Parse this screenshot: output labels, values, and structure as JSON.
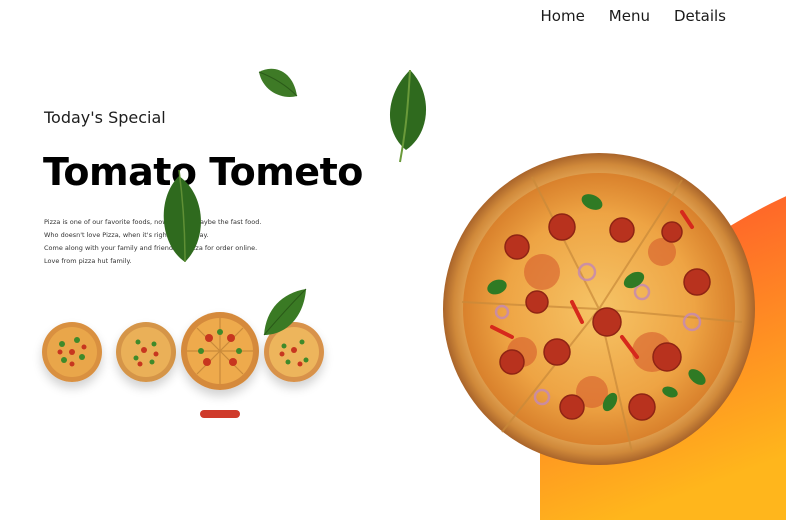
{
  "nav": {
    "items": [
      {
        "label": "Home"
      },
      {
        "label": "Menu"
      },
      {
        "label": "Details"
      }
    ]
  },
  "hero": {
    "subtitle": "Today's Special",
    "title": "Tomato Tometo",
    "description_lines": [
      "Pizza is one of our favorite foods, now-a-days maybe the fast food.",
      "Who doesn't love Pizza, when it's right by the way.",
      "Come along with your family and friends in Pizza for order online.",
      "Love from pizza hut family."
    ]
  },
  "colors": {
    "accent": "#cf3b2b",
    "orange_top": "#ff5a2a",
    "orange_bottom": "#ffb21c",
    "crust": "#d8913e",
    "cheese": "#f2b44c",
    "pepperoni": "#b8321e",
    "leaf": "#2f6a1e"
  },
  "thumbnails": [
    {
      "name": "pizza-thumbnail-1"
    },
    {
      "name": "pizza-thumbnail-2"
    },
    {
      "name": "pizza-thumbnail-3"
    },
    {
      "name": "pizza-thumbnail-4"
    }
  ]
}
